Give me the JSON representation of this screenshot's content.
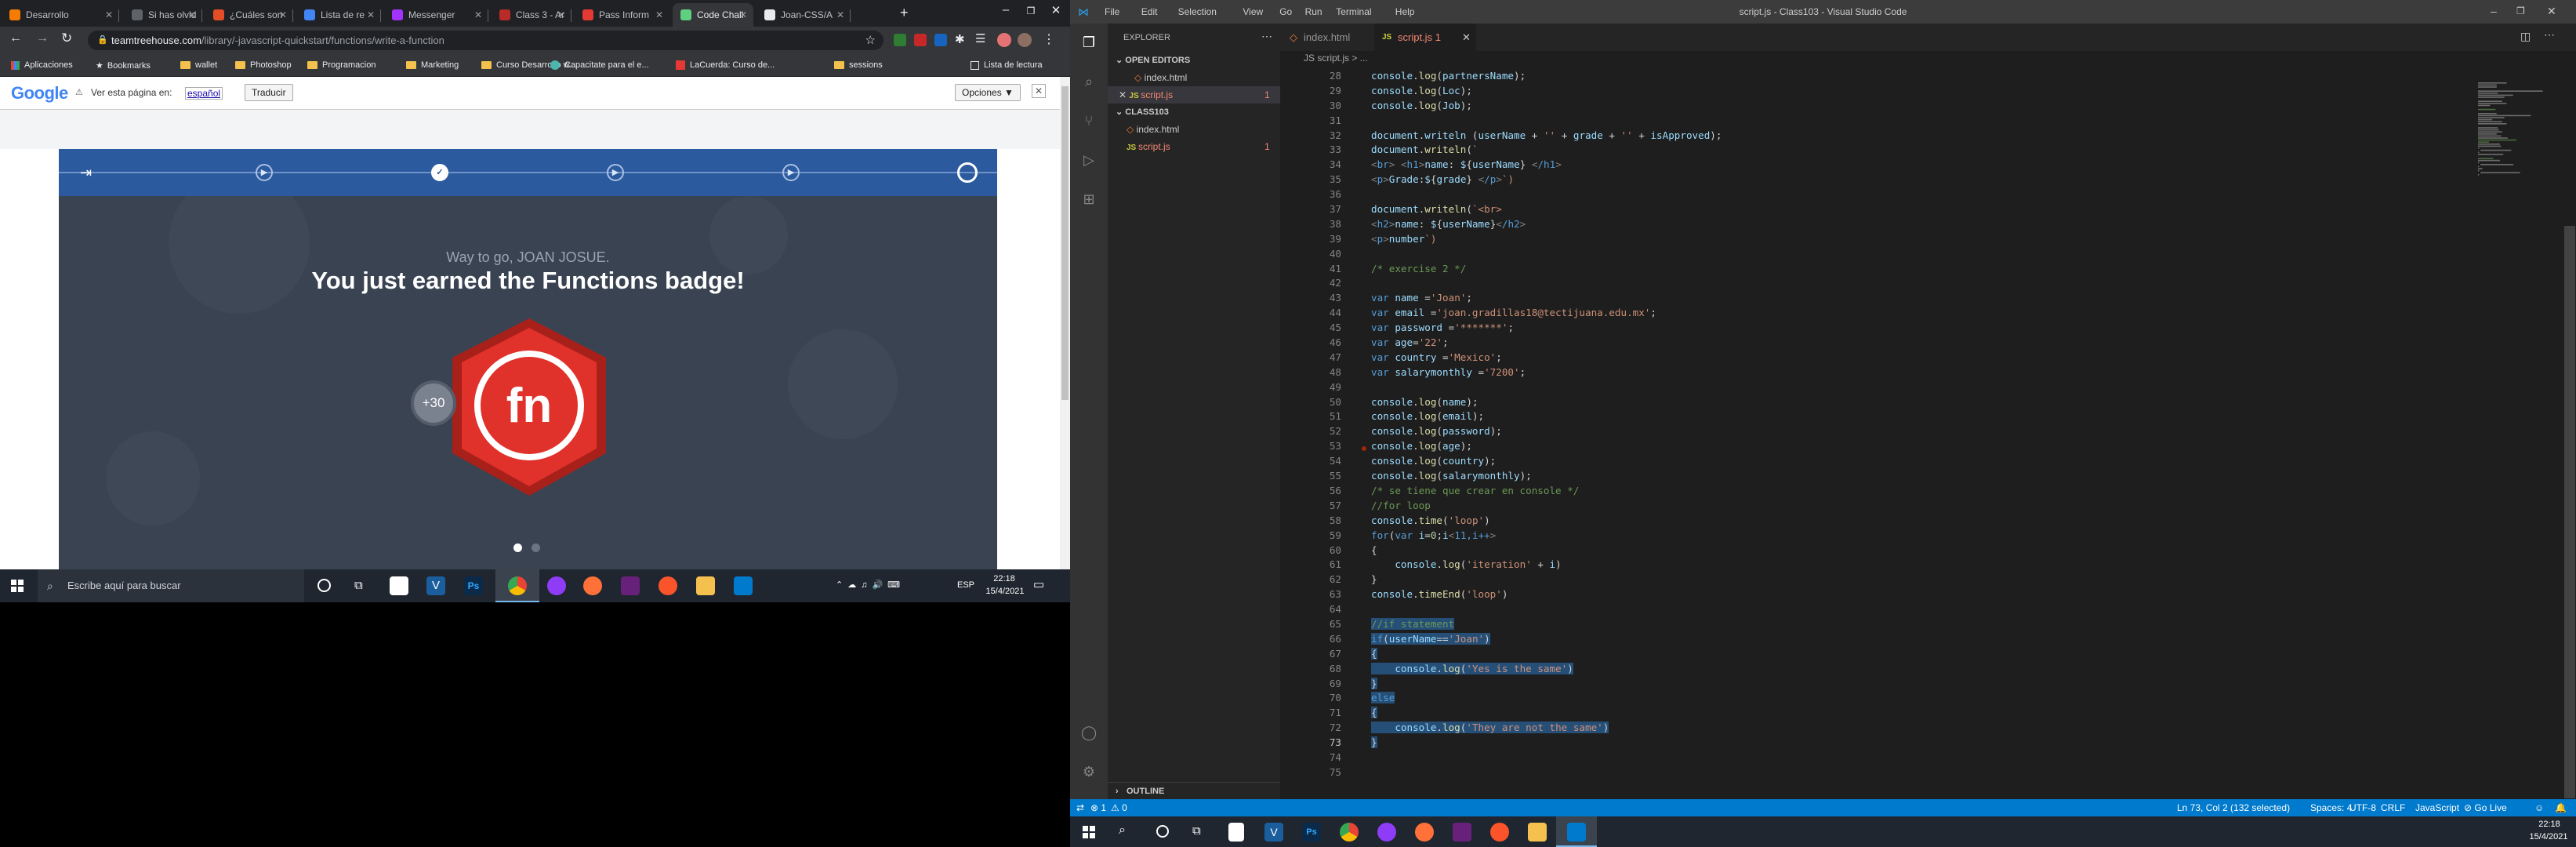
{
  "chrome": {
    "tabs": [
      {
        "label": "Desarrollo",
        "color": "#f57c00"
      },
      {
        "label": "Si has olvid",
        "color": "#5f6368"
      },
      {
        "label": "¿Cuáles son",
        "color": "#e44d26"
      },
      {
        "label": "Lista de re",
        "color": "#4285f4"
      },
      {
        "label": "Messenger",
        "color": "#a033ff"
      },
      {
        "label": "Class 3 - Ar",
        "color": "#b92b27"
      },
      {
        "label": "Pass Inform",
        "color": "#e53935"
      },
      {
        "label": "Code Chall",
        "color": "#5fcf80"
      },
      {
        "label": "Joan-CSS/A",
        "color": "#e8eaed"
      }
    ],
    "url_host": "teamtreehouse.com",
    "url_path": "/library/-javascript-quickstart/functions/write-a-function",
    "bookmarks": [
      "Aplicaciones",
      "Bookmarks",
      "wallet",
      "Photoshop",
      "Programacion",
      "Marketing",
      "Curso Desarrollo w...",
      "Capacitate para el e...",
      "LaCuerda: Curso de...",
      "sessions"
    ],
    "reading_list": "Lista de lectura",
    "translate": {
      "brand": "Google",
      "prompt": "Ver esta página en:",
      "language": "español",
      "button": "Traducir",
      "options": "Opciones ▼"
    }
  },
  "treehouse": {
    "small_text": "Way to go, JOAN JOSUE.",
    "headline": "You just earned the Functions badge!",
    "badge_text": "fn",
    "points": "+30"
  },
  "taskbar_left": {
    "search_placeholder": "Escribe aquí para buscar",
    "lang": "ESP",
    "time": "22:18",
    "date": "15/4/2021"
  },
  "vscode": {
    "title": "script.js - Class103 - Visual Studio Code",
    "menu": [
      "File",
      "Edit",
      "Selection",
      "View",
      "Go",
      "Run",
      "Terminal",
      "Help"
    ],
    "explorer_title": "EXPLORER",
    "open_editors": "OPEN EDITORS",
    "project": "CLASS103",
    "files": [
      {
        "name": "index.html",
        "badge": ""
      },
      {
        "name": "script.js",
        "badge": "1"
      }
    ],
    "tabs": [
      {
        "label": "index.html"
      },
      {
        "label": "script.js",
        "badge": "1"
      }
    ],
    "breadcrumb": "JS script.js > ...",
    "outline": "OUTLINE",
    "line_start": 28,
    "code_lines": [
      "console.log(partnersName);",
      "console.log(Loc);",
      "console.log(Job);",
      "",
      "document.writeln (userName + '' + grade + '' + isApproved);",
      "document.writeln(`",
      "<br> <h1>name: ${userName} </h1>",
      "<p>Grade:${grade} </p>`)",
      "",
      "document.writeln(`<br>",
      "<h2>name: ${userName}</h2>",
      "<p>number`)",
      "",
      "/* exercise 2 */",
      "",
      "var name ='Joan';",
      "var email ='joan.gradillas18@tectijuana.edu.mx';",
      "var password ='*******';",
      "var age='22';",
      "var country ='Mexico';",
      "var salarymonthly ='7200';",
      "",
      "console.log(name);",
      "console.log(email);",
      "console.log(password);",
      "console.log(age);",
      "console.log(country);",
      "console.log(salarymonthly);",
      "/* se tiene que crear en console */",
      "//for loop",
      "console.time('loop')",
      "for(var i=0;i<11,i++)",
      "{",
      "    console.log('iteration' + i)",
      "}",
      "console.timeEnd('loop')",
      "",
      "//if statement",
      "if(userName=='Joan')",
      "{",
      "    console.log('Yes is the same')",
      "}",
      "else",
      "{",
      "    console.log('They are not the same')",
      "}",
      "",
      ""
    ],
    "status": {
      "errors": "⊗ 1",
      "warnings": "⚠ 0",
      "position": "Ln 73, Col 2 (132 selected)",
      "spaces": "Spaces: 4",
      "encoding": "UTF-8",
      "eol": "CRLF",
      "language": "JavaScript",
      "golive": "⊘ Go Live"
    },
    "clock_time": "22:18",
    "clock_date": "15/4/2021"
  }
}
